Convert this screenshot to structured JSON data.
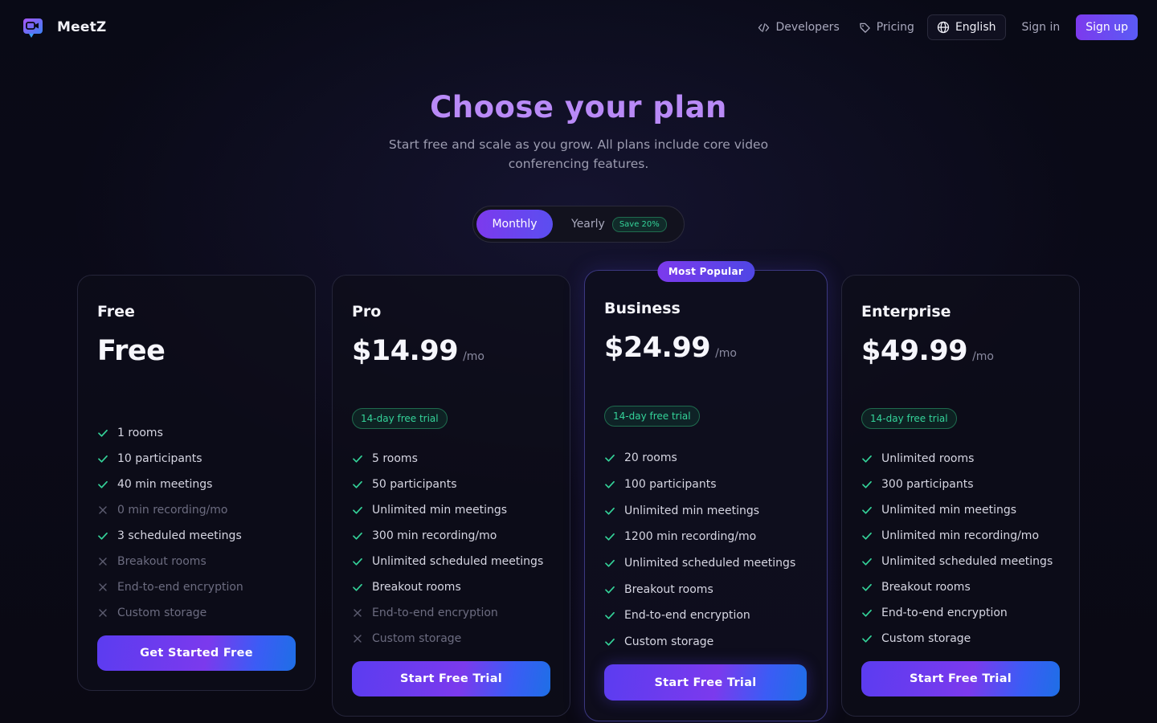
{
  "nav": {
    "brand": "MeetZ",
    "developers": "Developers",
    "pricing": "Pricing",
    "language": "English",
    "signin": "Sign in",
    "signup": "Sign up"
  },
  "hero": {
    "title": "Choose your plan",
    "subtitle": "Start free and scale as you grow. All plans include core video conferencing features."
  },
  "billing": {
    "monthly": "Monthly",
    "yearly": "Yearly",
    "save": "Save 20%"
  },
  "popular_badge": "Most Popular",
  "plans": [
    {
      "name": "Free",
      "price": "Free",
      "per": "",
      "trial": "",
      "cta": "Get Started Free",
      "features": [
        {
          "text": "1 rooms",
          "on": true
        },
        {
          "text": "10 participants",
          "on": true
        },
        {
          "text": "40 min meetings",
          "on": true
        },
        {
          "text": "0 min recording/mo",
          "on": false
        },
        {
          "text": "3 scheduled meetings",
          "on": true
        },
        {
          "text": "Breakout rooms",
          "on": false
        },
        {
          "text": "End-to-end encryption",
          "on": false
        },
        {
          "text": "Custom storage",
          "on": false
        }
      ]
    },
    {
      "name": "Pro",
      "price": "$14.99",
      "per": "/mo",
      "trial": "14-day free trial",
      "cta": "Start Free Trial",
      "features": [
        {
          "text": "5 rooms",
          "on": true
        },
        {
          "text": "50 participants",
          "on": true
        },
        {
          "text": "Unlimited min meetings",
          "on": true
        },
        {
          "text": "300 min recording/mo",
          "on": true
        },
        {
          "text": "Unlimited scheduled meetings",
          "on": true
        },
        {
          "text": "Breakout rooms",
          "on": true
        },
        {
          "text": "End-to-end encryption",
          "on": false
        },
        {
          "text": "Custom storage",
          "on": false
        }
      ]
    },
    {
      "name": "Business",
      "price": "$24.99",
      "per": "/mo",
      "trial": "14-day free trial",
      "cta": "Start Free Trial",
      "features": [
        {
          "text": "20 rooms",
          "on": true
        },
        {
          "text": "100 participants",
          "on": true
        },
        {
          "text": "Unlimited min meetings",
          "on": true
        },
        {
          "text": "1200 min recording/mo",
          "on": true
        },
        {
          "text": "Unlimited scheduled meetings",
          "on": true
        },
        {
          "text": "Breakout rooms",
          "on": true
        },
        {
          "text": "End-to-end encryption",
          "on": true
        },
        {
          "text": "Custom storage",
          "on": true
        }
      ]
    },
    {
      "name": "Enterprise",
      "price": "$49.99",
      "per": "/mo",
      "trial": "14-day free trial",
      "cta": "Start Free Trial",
      "features": [
        {
          "text": "Unlimited rooms",
          "on": true
        },
        {
          "text": "300 participants",
          "on": true
        },
        {
          "text": "Unlimited min meetings",
          "on": true
        },
        {
          "text": "Unlimited min recording/mo",
          "on": true
        },
        {
          "text": "Unlimited scheduled meetings",
          "on": true
        },
        {
          "text": "Breakout rooms",
          "on": true
        },
        {
          "text": "End-to-end encryption",
          "on": true
        },
        {
          "text": "Custom storage",
          "on": true
        }
      ]
    }
  ],
  "colors": {
    "accent": "#7c3aed",
    "title": "#b98af7",
    "check": "#34d399",
    "background": "#0a0a14"
  }
}
